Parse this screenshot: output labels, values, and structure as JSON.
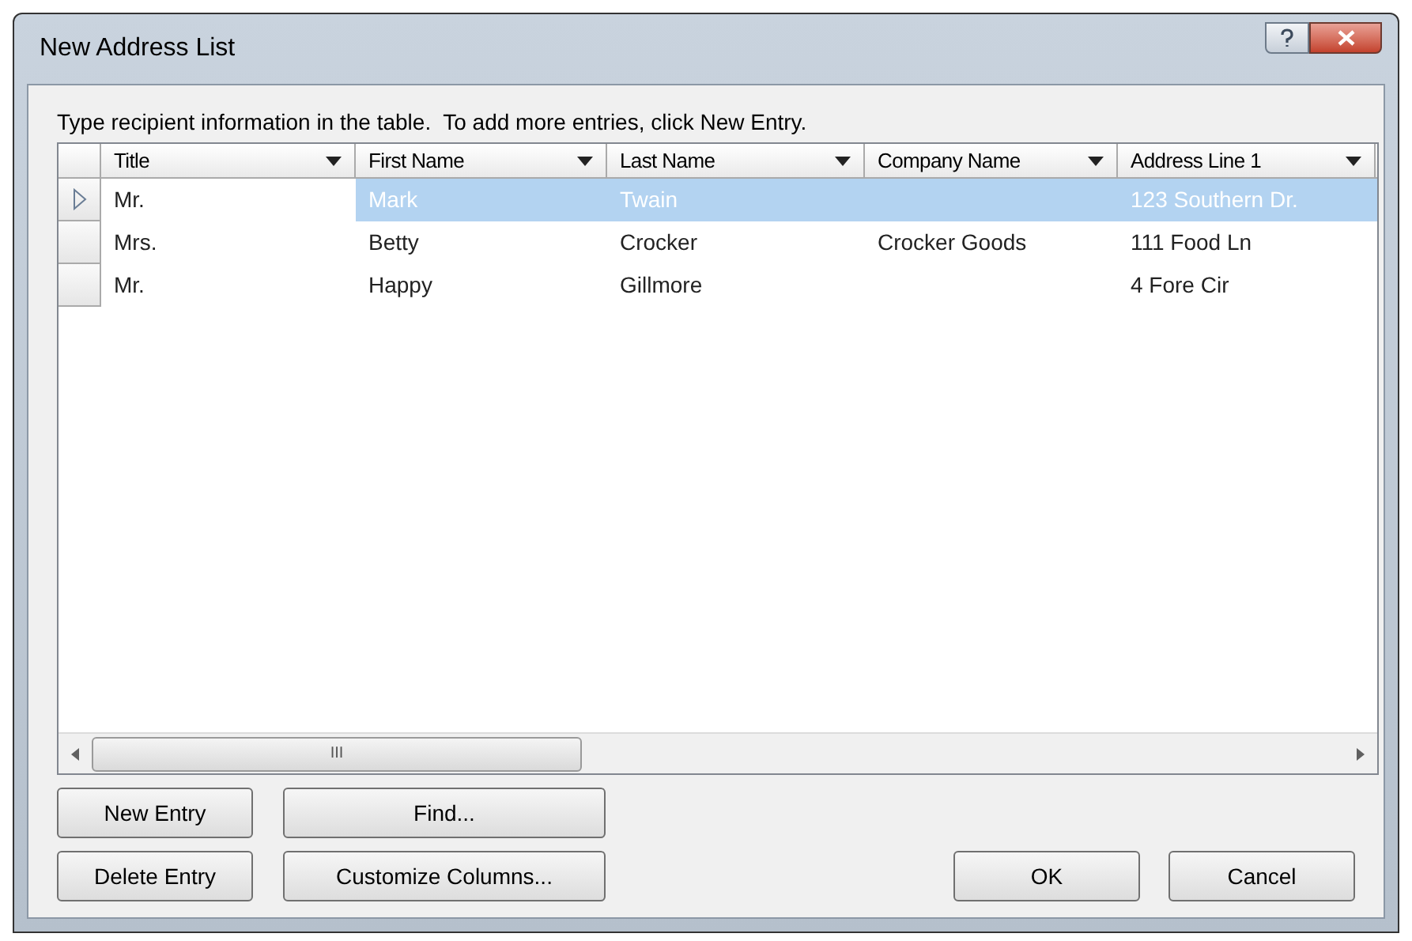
{
  "window": {
    "title": "New Address List"
  },
  "instruction": "Type recipient information in the table.  To add more entries, click New Entry.",
  "table": {
    "columns": [
      "Title",
      "First Name",
      "Last Name",
      "Company Name",
      "Address Line 1"
    ],
    "rows": [
      {
        "cells": [
          "Mr.",
          "Mark",
          "Twain",
          null,
          "123 Southern Dr."
        ],
        "selected": true
      },
      {
        "cells": [
          "Mrs.",
          "Betty",
          "Crocker",
          "Crocker Goods",
          "111 Food Ln"
        ],
        "selected": false
      },
      {
        "cells": [
          "Mr.",
          "Happy",
          "Gillmore",
          null,
          "4 Fore Cir"
        ],
        "selected": false
      }
    ]
  },
  "scrollbar_thumb": "III",
  "buttons_left": [
    [
      "New Entry",
      "Find..."
    ],
    [
      "Delete Entry",
      "Customize Columns..."
    ]
  ],
  "buttons_right": [
    "OK",
    "Cancel"
  ]
}
